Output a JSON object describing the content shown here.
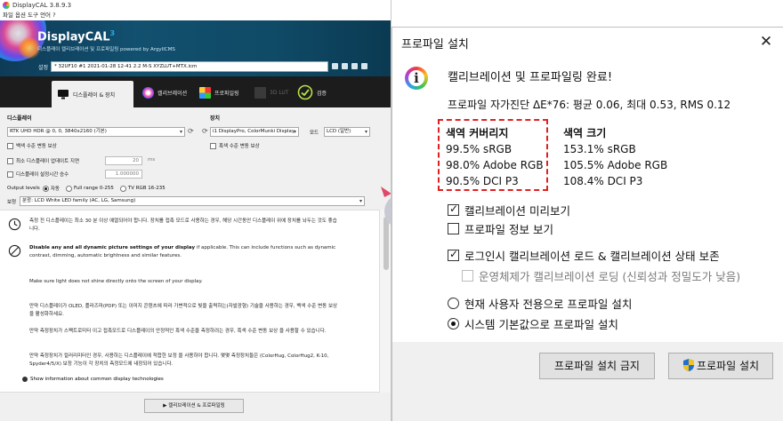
{
  "left": {
    "window_title": "DisplayCAL 3.8.9.3",
    "menu": "파일  옵션  도구  언어  ?",
    "brand": "DisplayCAL",
    "brand_sup": "3",
    "subtitle": "디스플레이 캘리브레이션 및 프로파일링 powered by ArgyllCMS",
    "settings_label": "설정",
    "settings_value": "* 32UF10 #1 2021-01-28 12-41 2.2 M-S XYZLUT+MTX.icm",
    "tabs": {
      "display": "디스플레이 & 장치",
      "calibration": "캘리브레이션",
      "profiling": "프로파일링",
      "lut3d": "3D LUT",
      "verification": "검증"
    },
    "display_section": "디스플레이",
    "display_value": "RTK UHD HDR @ 0, 0, 3840x2160 (기본)",
    "device_section": "장치",
    "device_value": "i1 DisplayPro, ColorMunki Display",
    "mode_label": "모드",
    "mode_value": "LCD (일반)",
    "white_level_drift": "백색 수준 변동 보상",
    "black_level_drift": "흑색 수준 변동 보상",
    "min_update_delay": "최소 디스플레이 업데이트 지연",
    "min_update_delay_value": "20",
    "min_update_delay_unit": "ms",
    "settle_multiplier": "디스플레이 설정시간 승수",
    "settle_multiplier_value": "1.000000",
    "output_levels_label": "Output levels",
    "output_auto": "자동",
    "output_full": "Full range 0-255",
    "output_tv": "TV RGB 16-235",
    "correction_label": "보정",
    "correction_value": "분광: LCD White LED family (AC, LG, Samsung)",
    "info1": "측정 전 디스플레이는 최소 30 분 이상 예열되어야 합니다. 장치를 접촉 모드로 사용하는 경우, 해당 시간동안 디스플레이 위에 장치를 놔두는 것도 좋습니다.",
    "info2_bold": "Disable any and all dynamic picture settings of your display",
    "info2_rest": " if applicable. This can include functions such as dynamic contrast, dimming, automatic brightness and similar features.",
    "info3": "Make sure light does not shine directly onto the screen of your display.",
    "info4": "만약 디스플레이가 OLED, 플라즈마(PDP) 또는 이미지 콘텐츠에 따라 가변적으로 빛을 출력하는(자발광형) 기술을 사용하는 경우, 백색 수준 변동 보상을 활성화하세요.",
    "info5": "만약 측정장치가 스펙트로미터 이고 접촉모드로 디스플레이의 안정적인 흑색 수준을 측정하려는 경우, 흑색 수준 변동 보상 을 사용할 수 있습니다.",
    "info6": "만약 측정장치가 컬러리미터인 경우, 사용하는 디스플레이에 적합한 보정 을 사용하야 합니다. 몇몇 측정장치들은 (ColorHug, ColorHug2, K-10, Spyder4/5/X) 보정 기능이 각 장치의 측정모드에 내장되어 있습니다.",
    "info_link": "Show information about common display technologies",
    "start_button": "캘리브레이션 & 프로파일링"
  },
  "dialog": {
    "title": "프로파일 설치",
    "complete": "캘리브레이션 및 프로파일링 완료!",
    "self_check": "프로파일 자가진단 ΔE*76: 평균 0.06, 최대 0.53, RMS 0.12",
    "coverage_head": "색역 커버리지",
    "coverage": [
      "99.5% sRGB",
      "98.0% Adobe RGB",
      "90.5% DCI P3"
    ],
    "volume_head": "색역 크기",
    "volume": [
      "153.1% sRGB",
      "105.5% Adobe RGB",
      "108.4% DCI P3"
    ],
    "preview_calibration": "캘리브레이션 미리보기",
    "show_profile_info": "프로파일 정보 보기",
    "load_calibration": "로그인시 캘리브레이션 로드 & 캘리브레이션 상태 보존",
    "os_loading": "운영체제가 캘리브레이션 로딩 (신뢰성과 정밀도가 낮음)",
    "install_current_user": "현재 사용자 전용으로 프로파일 설치",
    "install_system_default": "시스템 기본값으로 프로파일 설치",
    "cancel_button": "프로파일 설치 금지",
    "install_button": "프로파일 설치",
    "highlight_color": "#e02020"
  }
}
